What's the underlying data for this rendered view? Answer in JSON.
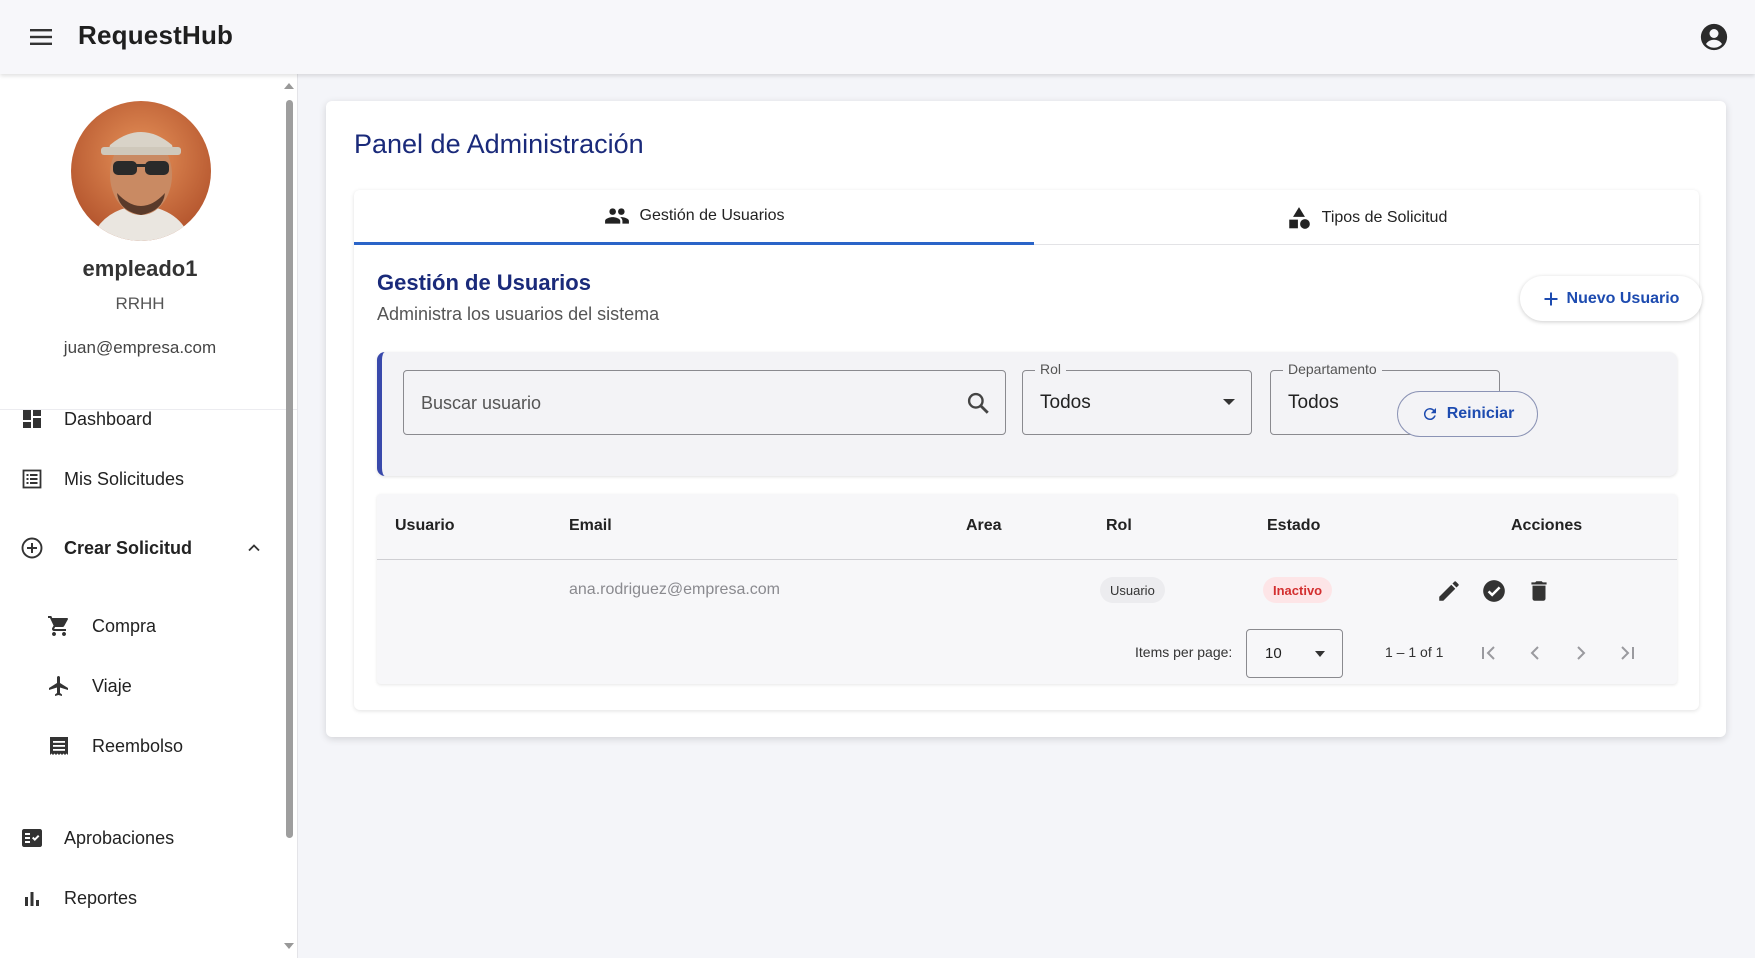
{
  "topbar": {
    "title": "RequestHub",
    "menu_icon": "menu-icon",
    "account_icon": "account-circle-icon"
  },
  "profile": {
    "username": "empleado1",
    "department": "RRHH",
    "email": "juan@empresa.com"
  },
  "sidebar": {
    "items": [
      {
        "label": "Dashboard",
        "icon": "dashboard-icon"
      },
      {
        "label": "Mis Solicitudes",
        "icon": "list-icon"
      },
      {
        "label": "Crear Solicitud",
        "icon": "add-circle-icon",
        "expanded": true
      },
      {
        "label": "Compra",
        "icon": "cart-icon"
      },
      {
        "label": "Viaje",
        "icon": "airplane-icon"
      },
      {
        "label": "Reembolso",
        "icon": "receipt-icon"
      },
      {
        "label": "Aprobaciones",
        "icon": "checklist-icon"
      },
      {
        "label": "Reportes",
        "icon": "bar-chart-icon"
      }
    ]
  },
  "main": {
    "title": "Panel de Administración",
    "tabs": [
      {
        "label": "Gestión de Usuarios",
        "icon": "group-icon",
        "active": true
      },
      {
        "label": "Tipos de Solicitud",
        "icon": "category-icon",
        "active": false
      }
    ],
    "section": {
      "title": "Gestión de Usuarios",
      "subtitle": "Administra los usuarios del sistema",
      "new_button": "Nuevo Usuario"
    },
    "filters": {
      "search_placeholder": "Buscar usuario",
      "role_label": "Rol",
      "role_value": "Todos",
      "dept_label": "Departamento",
      "dept_value": "Todos",
      "reset_button": "Reiniciar"
    },
    "table": {
      "columns": [
        "Usuario",
        "Email",
        "Area",
        "Rol",
        "Estado",
        "Acciones"
      ],
      "rows": [
        {
          "usuario": "",
          "email": "ana.rodriguez@empresa.com",
          "area": "",
          "rol": "Usuario",
          "estado": "Inactivo"
        }
      ]
    },
    "pagination": {
      "items_per_page_label": "Items per page:",
      "items_per_page": "10",
      "range": "1 – 1 of 1"
    }
  },
  "colors": {
    "accent": "#1a2a7a",
    "link": "#1d4bb0",
    "tab_indicator": "#2a64c8",
    "filter_border": "#3949ab",
    "inactive": "#d32f2f"
  }
}
